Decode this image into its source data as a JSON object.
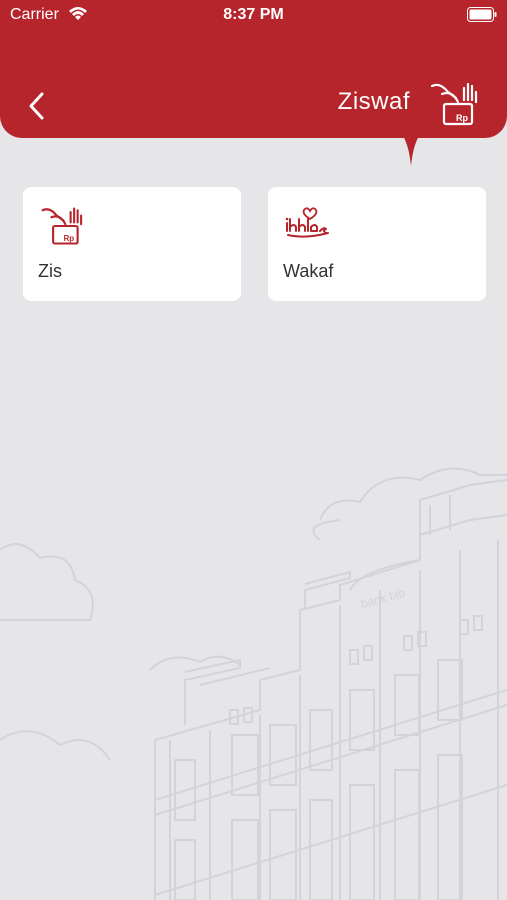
{
  "status_bar": {
    "carrier": "Carrier",
    "time": "8:37 PM"
  },
  "header": {
    "title": "Ziswaf",
    "icon": "zis-hand-box-icon",
    "back_icon": "chevron-left-icon"
  },
  "menu": [
    {
      "label": "Zis",
      "icon": "zis-hand-box-icon"
    },
    {
      "label": "Wakaf",
      "icon": "ikhlas-logo-icon"
    }
  ],
  "background": {
    "illustration": "bank-building-line-art",
    "sign_text": "bank bjb"
  },
  "colors": {
    "brand": "#b6242c",
    "background": "#e6e6e8",
    "card": "#ffffff"
  }
}
